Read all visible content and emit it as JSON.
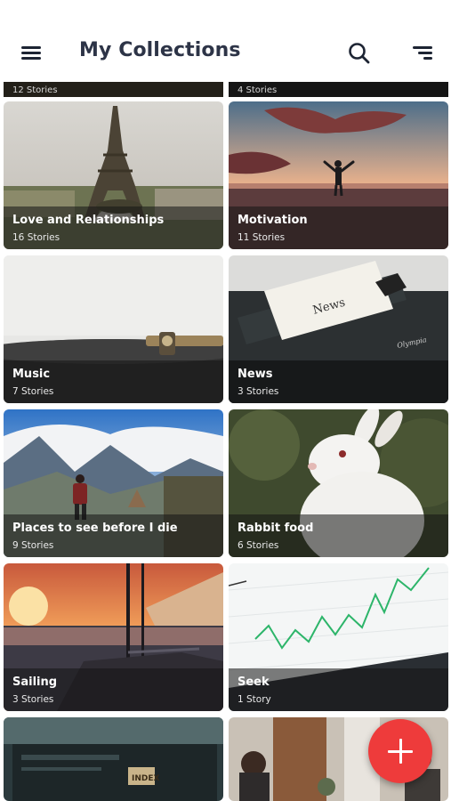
{
  "header": {
    "title": "My Collections",
    "menu_icon": "hamburger-menu-icon",
    "search_icon": "search-icon",
    "sort_icon": "sort-icon"
  },
  "partial_row": [
    {
      "count": "12 Stories"
    },
    {
      "count": "4 Stories"
    }
  ],
  "collections": [
    {
      "name": "Love and Relationships",
      "count": "16 Stories"
    },
    {
      "name": "Motivation",
      "count": "11 Stories"
    },
    {
      "name": "Music",
      "count": "7 Stories"
    },
    {
      "name": "News",
      "count": "3 Stories"
    },
    {
      "name": "Places to see before I die",
      "count": "9 Stories"
    },
    {
      "name": "Rabbit food",
      "count": "6 Stories"
    },
    {
      "name": "Sailing",
      "count": "3 Stories"
    },
    {
      "name": "Seek",
      "count": "1 Story"
    }
  ],
  "image_text": {
    "typewriter_paper": "News",
    "typewriter_brand": "Olympia",
    "electronics_label": "INDEX"
  },
  "fab": {
    "icon": "plus-icon"
  },
  "colors": {
    "accent": "#ee3b3b",
    "title": "#2d3447",
    "background": "#ffffff"
  }
}
